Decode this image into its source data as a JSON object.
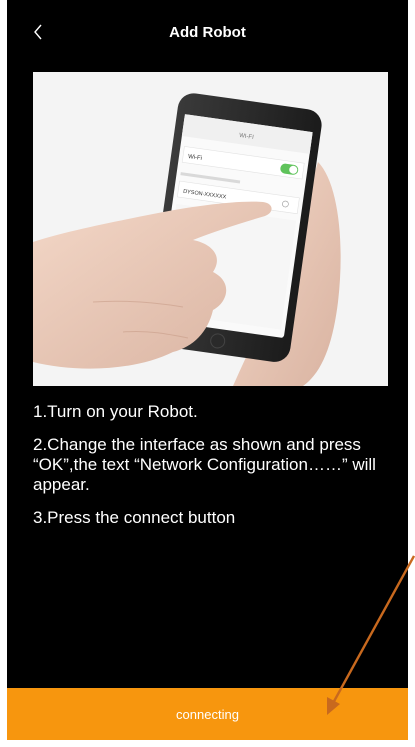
{
  "header": {
    "title": "Add Robot"
  },
  "illustration": {
    "phone_header": "WI-FI",
    "wifi_label": "Wi-Fi",
    "network_name": "DYSON-XXXXXX"
  },
  "instructions": [
    "1.Turn on your Robot.",
    "2.Change the interface as shown and press “OK”,the text “Network Configuration……” will appear.",
    "3.Press the connect button"
  ],
  "bottom": {
    "button_label": "connecting"
  },
  "colors": {
    "accent": "#f7960e",
    "background": "#000000",
    "annotation_arrow": "#c8691e"
  }
}
